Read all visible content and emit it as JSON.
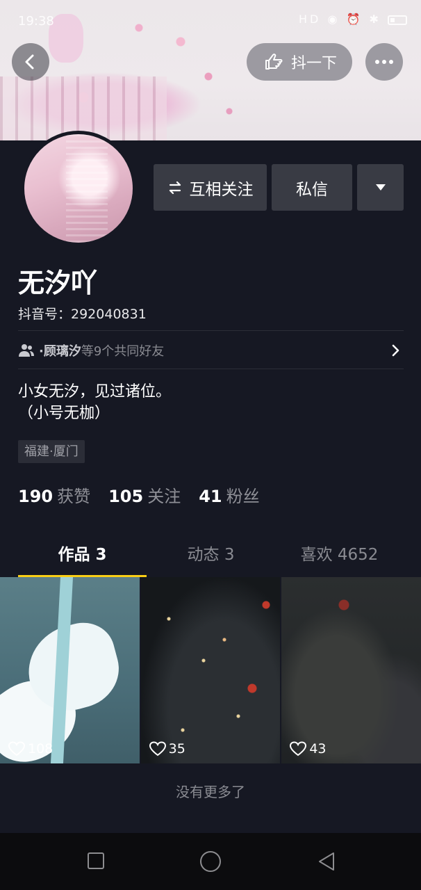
{
  "status_bar": {
    "time": "19:38",
    "icons": "HD ◉ ⏰ ✱"
  },
  "header": {
    "poke_label": "抖一下"
  },
  "profile": {
    "name": "无汐吖",
    "douyin_id": "抖音号：292040831",
    "follow_button": "互相关注",
    "message_button": "私信",
    "mutual_friends": {
      "highlight": "·顾璃汐",
      "text": "等9个共同好友"
    },
    "bio_lines": [
      "小女无汐，见过诸位。",
      "（小号无枷）"
    ],
    "location": "福建·厦门",
    "stats": [
      {
        "value": "190",
        "label": "获赞"
      },
      {
        "value": "105",
        "label": "关注"
      },
      {
        "value": "41",
        "label": "粉丝"
      }
    ]
  },
  "tabs": [
    {
      "label": "作品 3",
      "active": true
    },
    {
      "label": "动态 3",
      "active": false
    },
    {
      "label": "喜欢 4652",
      "active": false
    }
  ],
  "videos": [
    {
      "likes": "108"
    },
    {
      "likes": "35"
    },
    {
      "likes": "43"
    }
  ],
  "footer_text": "没有更多了",
  "colors": {
    "background": "#161823",
    "tab_indicator": "#face15",
    "button_bg": "#393b44"
  }
}
